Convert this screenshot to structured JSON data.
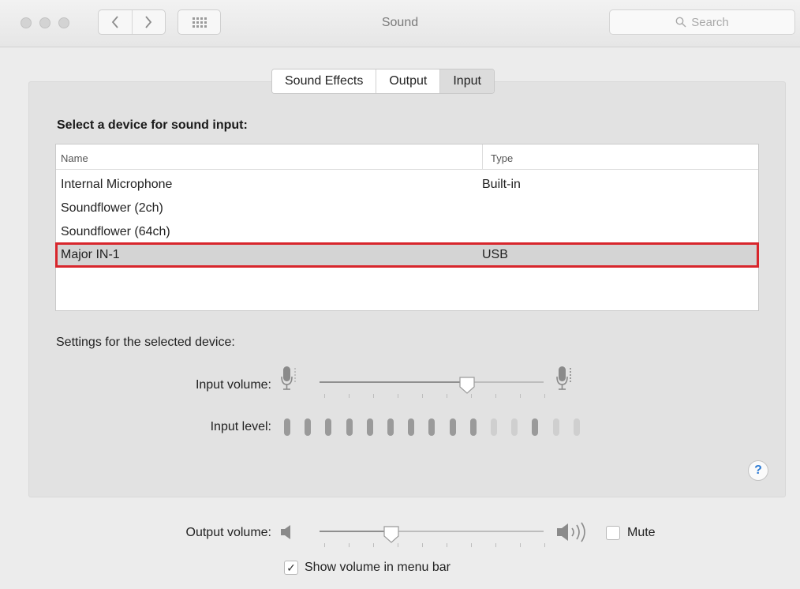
{
  "window": {
    "title": "Sound",
    "search_placeholder": "Search"
  },
  "tabs": [
    {
      "label": "Sound Effects",
      "active": false
    },
    {
      "label": "Output",
      "active": false
    },
    {
      "label": "Input",
      "active": true
    }
  ],
  "input_panel": {
    "section_title": "Select a device for sound input:",
    "columns": [
      "Name",
      "Type"
    ],
    "devices": [
      {
        "name": "Internal Microphone",
        "type": "Built-in",
        "selected": false
      },
      {
        "name": "Soundflower (2ch)",
        "type": "",
        "selected": false
      },
      {
        "name": "Soundflower (64ch)",
        "type": "",
        "selected": false
      },
      {
        "name": "Major IN-1",
        "type": "USB",
        "selected": true
      }
    ],
    "settings_label": "Settings for the selected device:",
    "input_volume_label": "Input volume:",
    "input_volume_fraction": 0.66,
    "input_level_label": "Input level:",
    "input_level_active_segments": 10,
    "input_level_total_segments": 15
  },
  "help_label": "?",
  "footer": {
    "output_volume_label": "Output volume:",
    "output_volume_fraction": 0.32,
    "mute_label": "Mute",
    "mute_checked": false,
    "show_volume_label": "Show volume in menu bar",
    "show_volume_checked": true,
    "check_glyph": "✓"
  },
  "colors": {
    "selection_outline": "#d8262c",
    "level_active": "#9a9a9a",
    "level_inactive": "#cfcfcf",
    "help_blue": "#2e7bd4"
  }
}
